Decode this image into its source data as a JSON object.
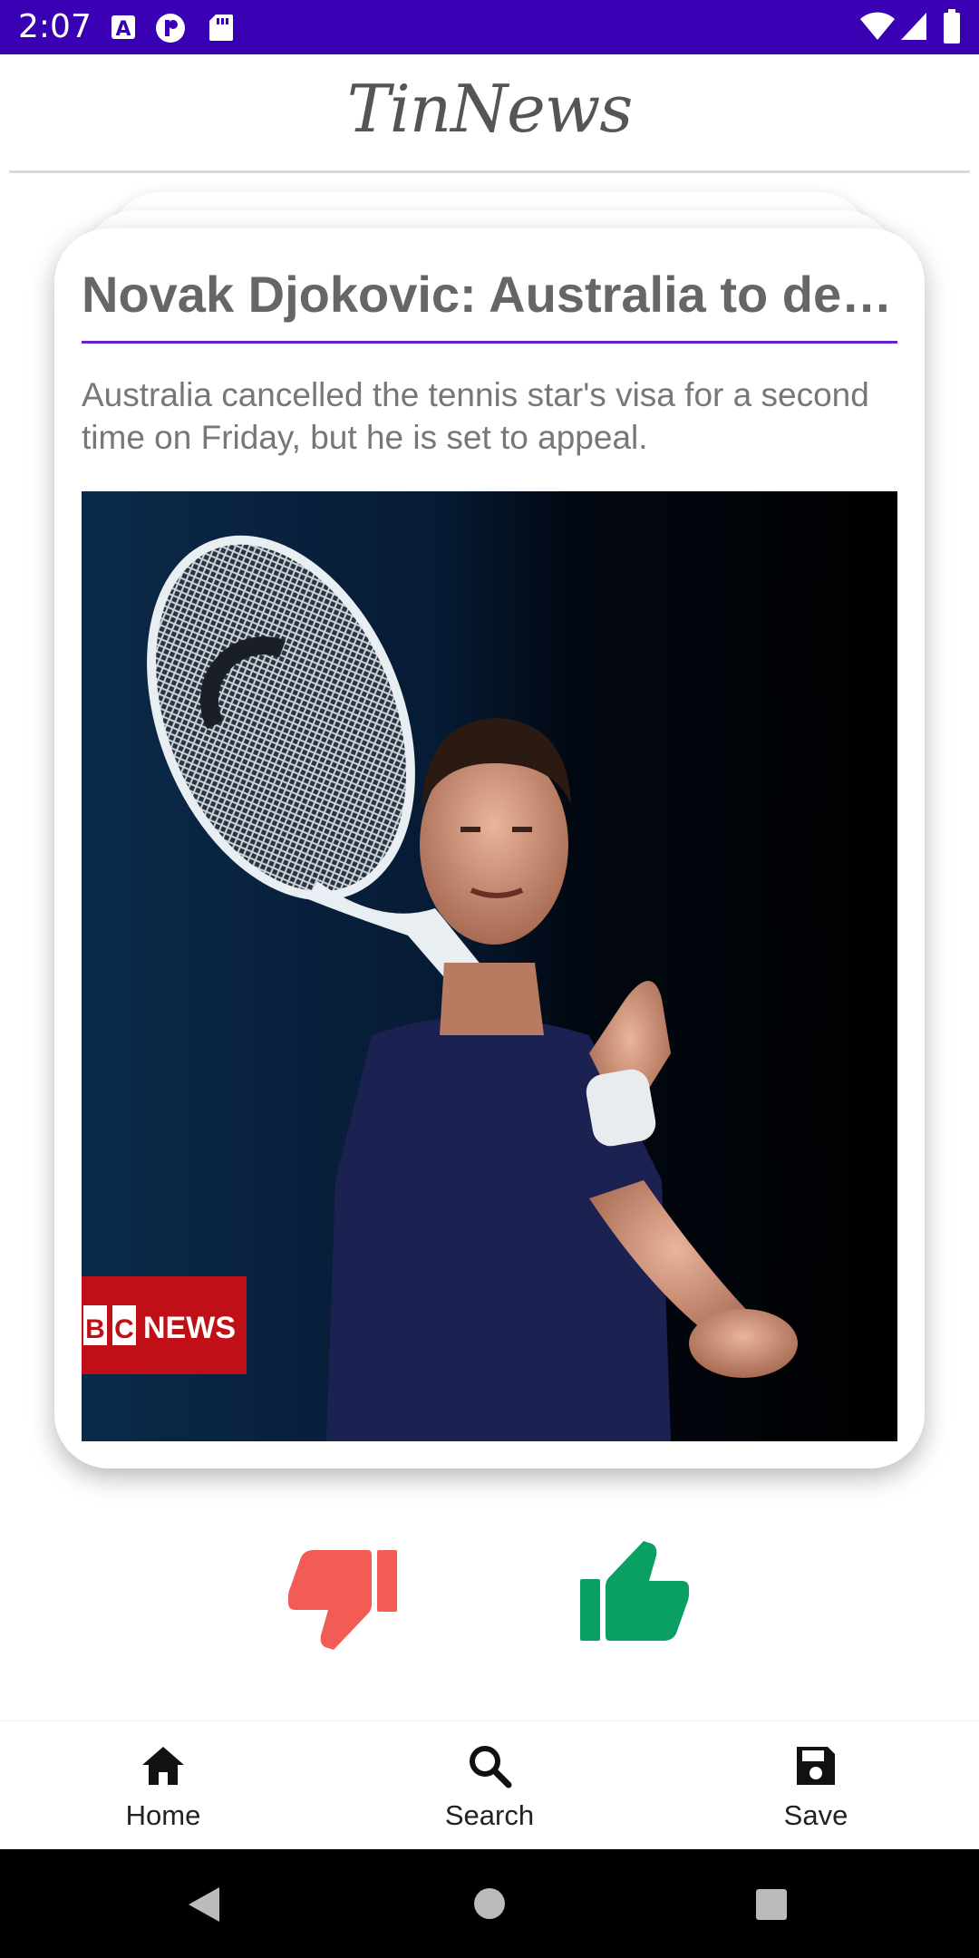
{
  "status_bar": {
    "time": "2:07",
    "icons": [
      "notification-a-icon",
      "notification-p-icon",
      "sd-card-icon",
      "wifi-icon",
      "signal-icon",
      "battery-icon"
    ]
  },
  "app": {
    "title": "TinNews"
  },
  "article": {
    "title": "Novak Djokovic: Australia to de…",
    "description": "Australia cancelled the tennis star's visa for a second time on Friday, but he is set to appeal.",
    "image_watermark": "BBC NEWS"
  },
  "actions": {
    "dislike_icon": "thumbs-down-icon",
    "like_icon": "thumbs-up-icon"
  },
  "bottom_nav": {
    "items": [
      {
        "label": "Home",
        "icon": "home-icon"
      },
      {
        "label": "Search",
        "icon": "search-icon"
      },
      {
        "label": "Save",
        "icon": "save-icon"
      }
    ]
  },
  "system_nav": {
    "buttons": [
      "back",
      "home",
      "recents"
    ]
  },
  "colors": {
    "status_bar": "#3a00b3",
    "accent": "#6a1fd1",
    "dislike": "#f25c54",
    "like": "#0a9f63"
  }
}
